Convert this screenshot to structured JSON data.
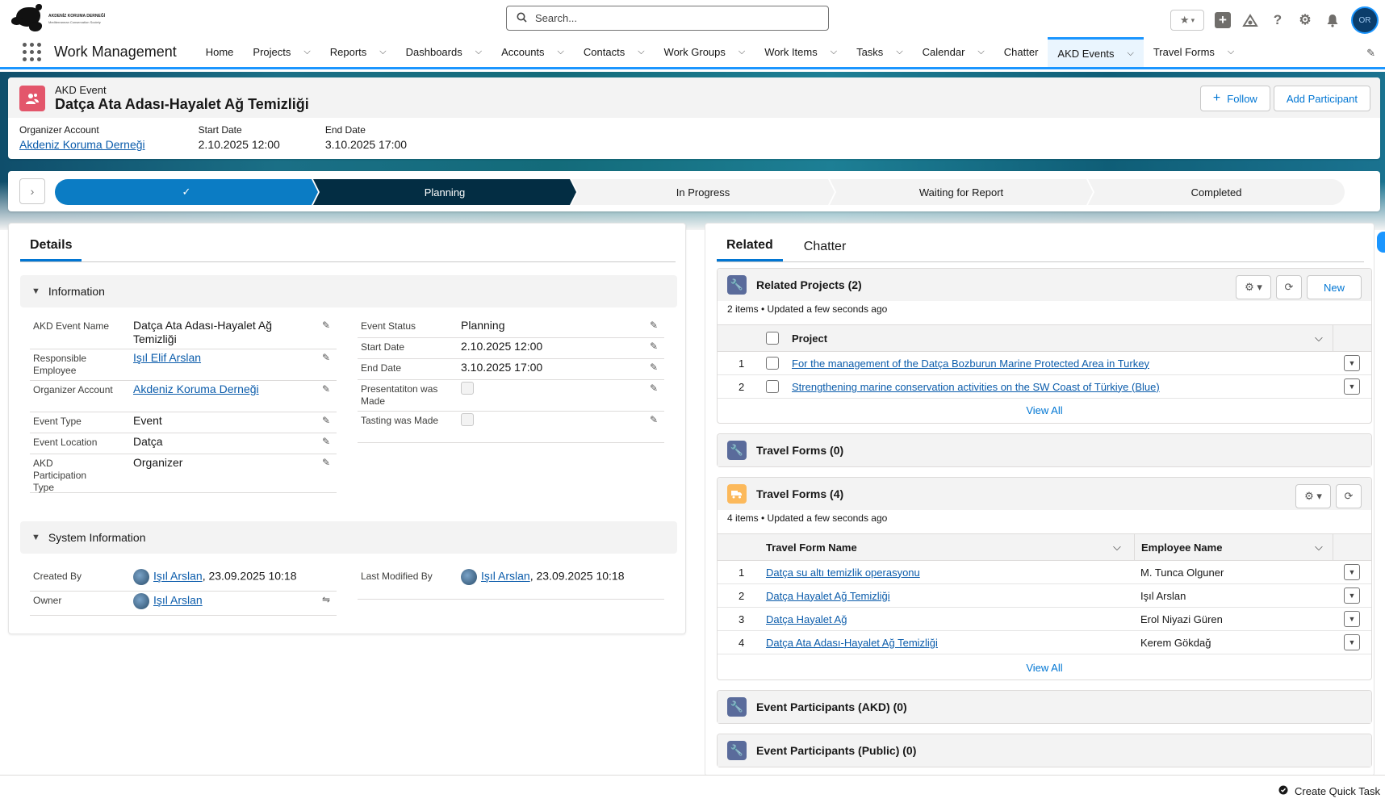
{
  "header": {
    "org_name": "AKDENİZ KORUMA DERNEĞİ",
    "org_tagline": "Mediterranean Conservation Society",
    "search_placeholder": "Search...",
    "icons": [
      "star-icon",
      "add-icon",
      "trailhead-icon",
      "help-icon",
      "setup-gear-icon",
      "notifications-bell-icon",
      "user-avatar-icon"
    ],
    "avatar_initials": "OR"
  },
  "nav": {
    "app_name": "Work Management",
    "items": [
      {
        "label": "Home",
        "dropdown": false
      },
      {
        "label": "Projects",
        "dropdown": true
      },
      {
        "label": "Reports",
        "dropdown": true
      },
      {
        "label": "Dashboards",
        "dropdown": true
      },
      {
        "label": "Accounts",
        "dropdown": true
      },
      {
        "label": "Contacts",
        "dropdown": true
      },
      {
        "label": "Work Groups",
        "dropdown": true
      },
      {
        "label": "Work Items",
        "dropdown": true
      },
      {
        "label": "Tasks",
        "dropdown": true
      },
      {
        "label": "Calendar",
        "dropdown": true
      },
      {
        "label": "Chatter",
        "dropdown": false
      },
      {
        "label": "AKD Events",
        "dropdown": true,
        "active": true
      },
      {
        "label": "Travel Forms",
        "dropdown": true
      }
    ]
  },
  "record": {
    "type": "AKD Event",
    "title": "Datça Ata Adası-Hayalet Ağ Temizliği",
    "follow_label": "Follow",
    "add_participant_label": "Add Participant",
    "highlights": [
      {
        "label": "Organizer Account",
        "value": "Akdeniz Koruma Derneği",
        "link": true
      },
      {
        "label": "Start Date",
        "value": "2.10.2025 12:00",
        "link": false
      },
      {
        "label": "End Date",
        "value": "3.10.2025 17:00",
        "link": false
      }
    ]
  },
  "path": {
    "stages": [
      {
        "label": "✓",
        "state": "done"
      },
      {
        "label": "Planning",
        "state": "current"
      },
      {
        "label": "In Progress",
        "state": "todo"
      },
      {
        "label": "Waiting for Report",
        "state": "todo"
      },
      {
        "label": "Completed",
        "state": "todo"
      }
    ]
  },
  "details": {
    "tab_label": "Details",
    "information_label": "Information",
    "system_information_label": "System Information",
    "left_fields": [
      {
        "label": "AKD Event Name",
        "value": "Datça Ata Adası-Hayalet Ağ Temizliği"
      },
      {
        "label": "Responsible Employee",
        "value": "Işıl Elif Arslan",
        "link": true
      },
      {
        "label": "Organizer Account",
        "value": "Akdeniz Koruma Derneği",
        "link": true
      },
      {
        "label": "Event Type",
        "value": "Event"
      },
      {
        "label": "Event Location",
        "value": "Datça"
      },
      {
        "label": "AKD Participation Type",
        "value": "Organizer"
      }
    ],
    "right_fields": [
      {
        "label": "Event Status",
        "value": "Planning"
      },
      {
        "label": "Start Date",
        "value": "2.10.2025 12:00"
      },
      {
        "label": "End Date",
        "value": "3.10.2025 17:00"
      },
      {
        "label": "Presentatiton was Made",
        "checkbox": true,
        "checked": false
      },
      {
        "label": "Tasting was Made",
        "checkbox": true,
        "checked": false
      }
    ],
    "system": {
      "created_by_label": "Created By",
      "created_by_user": "Işıl Arslan",
      "created_by_date": ", 23.09.2025 10:18",
      "owner_label": "Owner",
      "owner_user": "Işıl Arslan",
      "modified_label": "Last Modified By",
      "modified_user": "Işıl Arslan",
      "modified_date": ", 23.09.2025 10:18"
    }
  },
  "related": {
    "tabs": [
      "Related",
      "Chatter"
    ],
    "projects": {
      "title": "Related Projects (2)",
      "subtitle": "2 items • Updated a few seconds ago",
      "new_label": "New",
      "column": "Project",
      "rows": [
        {
          "n": "1",
          "name": "For the management of the Datça Bozburun Marine Protected Area in Turkey"
        },
        {
          "n": "2",
          "name": "Strengthening marine conservation activities on the SW Coast of Türkiye (Blue)"
        }
      ],
      "view_all": "View All"
    },
    "travel_forms_empty": {
      "title": "Travel Forms (0)"
    },
    "travel_forms": {
      "title": "Travel Forms (4)",
      "subtitle": "4 items • Updated a few seconds ago",
      "columns": [
        "Travel Form Name",
        "Employee Name"
      ],
      "rows": [
        {
          "n": "1",
          "name": "Datça su altı temizlik operasyonu",
          "employee": "M. Tunca Olguner"
        },
        {
          "n": "2",
          "name": "Datça Hayalet Ağ Temizliği",
          "employee": "Işıl Arslan"
        },
        {
          "n": "3",
          "name": "Datça Hayalet Ağ",
          "employee": "Erol Niyazi Güren"
        },
        {
          "n": "4",
          "name": "Datça Ata Adası-Hayalet Ağ Temizliği",
          "employee": "Kerem Gökdağ"
        }
      ],
      "view_all": "View All"
    },
    "participants_akd": {
      "title": "Event Participants (AKD) (0)"
    },
    "participants_public": {
      "title": "Event Participants (Public) (0)"
    }
  },
  "utility": {
    "quick_task_label": "Create Quick Task"
  },
  "colors": {
    "brand": "#1b96ff",
    "path_done": "#0b7cc4",
    "path_current": "#032d43",
    "record_icon": "#e3566b",
    "related_icon": "#5a6b9b",
    "travel_icon": "#fcb95b"
  }
}
